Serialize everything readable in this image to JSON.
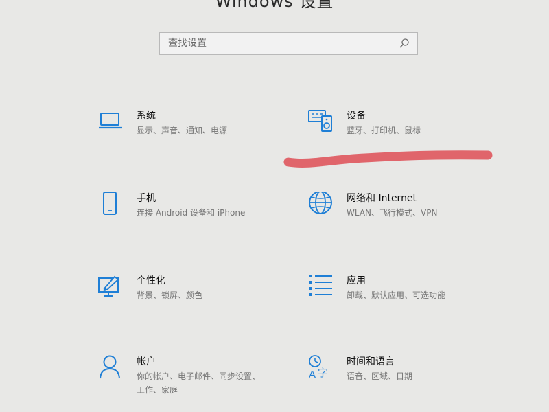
{
  "window": {
    "title": "Windows 设置"
  },
  "search": {
    "placeholder": "查找设置",
    "value": ""
  },
  "icons": {
    "search": "search-icon",
    "system": "laptop-icon",
    "devices": "keyboard-speaker-icon",
    "phone": "phone-icon",
    "network": "globe-icon",
    "personalization": "paint-screen-icon",
    "apps": "list-icon",
    "accounts": "person-icon",
    "time_language": "clock-language-icon"
  },
  "colors": {
    "accent": "#1f7fd6",
    "background": "#e8e8e6",
    "annotation": "#e0656b"
  },
  "tiles": [
    {
      "id": "system",
      "title": "系统",
      "desc": "显示、声音、通知、电源"
    },
    {
      "id": "devices",
      "title": "设备",
      "desc": "蓝牙、打印机、鼠标"
    },
    {
      "id": "phone",
      "title": "手机",
      "desc": "连接 Android 设备和 iPhone"
    },
    {
      "id": "network",
      "title": "网络和 Internet",
      "desc": "WLAN、飞行模式、VPN"
    },
    {
      "id": "personalization",
      "title": "个性化",
      "desc": "背景、锁屏、颜色"
    },
    {
      "id": "apps",
      "title": "应用",
      "desc": "卸载、默认应用、可选功能"
    },
    {
      "id": "accounts",
      "title": "帐户",
      "desc": "你的帐户、电子邮件、同步设置、工作、家庭"
    },
    {
      "id": "time_language",
      "title": "时间和语言",
      "desc": "语音、区域、日期"
    }
  ]
}
